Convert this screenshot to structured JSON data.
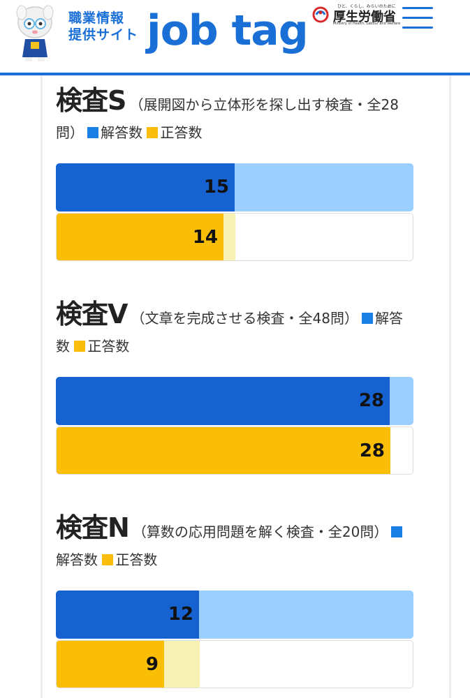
{
  "header": {
    "site_line1": "職業情報",
    "site_line2": "提供サイト",
    "logo_text": "job tag",
    "ministry_tagline": "ひと、くらし、みらいのために",
    "ministry_name": "厚生労働省",
    "ministry_en": "Ministry of Health, Labour and Welfare",
    "menu_icon": "hamburger-menu-icon",
    "brand_color": "#1a6fd6"
  },
  "legend": {
    "answers": "解答数",
    "correct": "正答数",
    "answers_color": "#1a80e6",
    "correct_color": "#f9bd0b"
  },
  "chart_data": [
    {
      "type": "bar",
      "title": "検査S",
      "description": "（展開図から立体形を探し出す検査・全28問）",
      "total": 28,
      "series": [
        {
          "name": "解答数",
          "value": 15
        },
        {
          "name": "正答数",
          "value": 14
        }
      ]
    },
    {
      "type": "bar",
      "title": "検査V",
      "description": "（文章を完成させる検査・全48問）",
      "total": 48,
      "series": [
        {
          "name": "解答数",
          "value": 28
        },
        {
          "name": "正答数",
          "value": 28
        }
      ]
    },
    {
      "type": "bar",
      "title": "検査N",
      "description": "（算数の応用問題を解く検査・全20問）",
      "total": 20,
      "series": [
        {
          "name": "解答数",
          "value": 12
        },
        {
          "name": "正答数",
          "value": 9
        }
      ]
    }
  ]
}
